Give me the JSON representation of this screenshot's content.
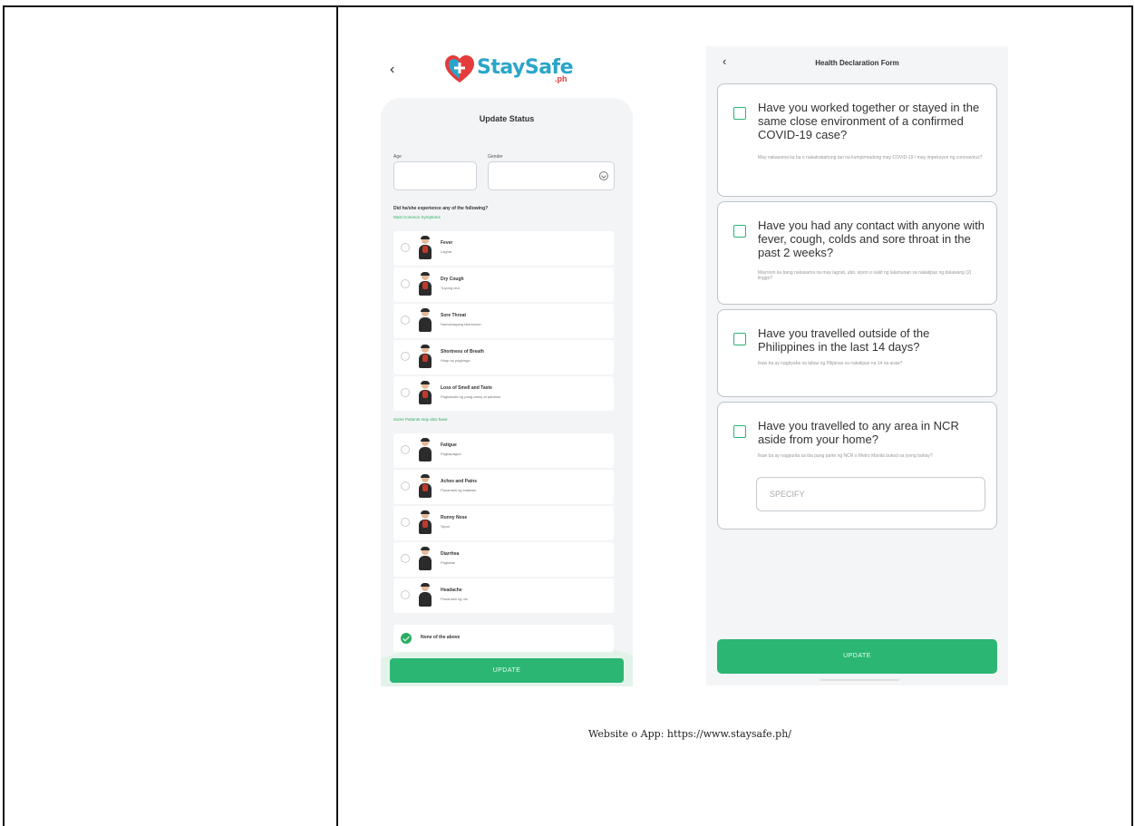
{
  "phone1": {
    "logo_text": "StaySafe",
    "logo_sub": ".ph",
    "title": "Update Status",
    "age_label": "Age",
    "gender_label": "Gender",
    "question": "Did he/she experience any of the following?",
    "section_common": "Most Common Symptoms",
    "section_some": "Some Patients may also have",
    "symptoms": [
      {
        "name": "Fever",
        "sub": "Lagnat"
      },
      {
        "name": "Dry Cough",
        "sub": "Tuyong ubo"
      },
      {
        "name": "Sore Throat",
        "sub": "Namamagang lalamunan"
      },
      {
        "name": "Shortness of Breath",
        "sub": "Hirap sa paghinga"
      },
      {
        "name": "Loss of Smell and Taste",
        "sub": "Pagkawala ng pang-amoy at panlasa"
      }
    ],
    "symptoms_more": [
      {
        "name": "Fatigue",
        "sub": "Pagkapagod"
      },
      {
        "name": "Aches and Pains",
        "sub": "Pananakit ng katawan"
      },
      {
        "name": "Runny Nose",
        "sub": "Sipon"
      },
      {
        "name": "Diarrhea",
        "sub": "Pagtatae"
      },
      {
        "name": "Headache",
        "sub": "Pananakit ng ulo"
      }
    ],
    "none_label": "None of the above",
    "update_label": "UPDATE"
  },
  "phone2": {
    "title": "Health Declaration Form",
    "questions": [
      {
        "q": "Have you worked together or stayed in the same close environment of a confirmed COVID-19 case?",
        "tr": "May nakasama ka ba o nakatrabahong tao na kumpirmadong may COVID-19 / may impeksyon ng coronavirus?"
      },
      {
        "q": "Have you had any contact with anyone with fever, cough, colds and sore throat in the past 2 weeks?",
        "tr": "Mayroon ka bang nakasama na may lagnat, ubo, sipon o sakit ng lalamunan sa nakalipas ng dalawang (2) linggo?"
      },
      {
        "q": "Have you travelled outside of the Philippines in the last 14 days?",
        "tr": "Ikaw ba ay nagbyahe sa labas ng Pilipinas sa nakalipas na 14 na araw?"
      },
      {
        "q": "Have you travelled to any area in NCR aside from your home?",
        "tr": "Ikaw ba ay nagpunta sa iba pang parte ng NCR o Metro Manila bukod sa iyong bahay?"
      }
    ],
    "specify_placeholder": "SPECIFY",
    "update_label": "UPDATE"
  },
  "caption": "Website o App: https://www.staysafe.ph/",
  "colors": {
    "accent": "#2bb673",
    "brand_blue": "#2aa5c9",
    "brand_red": "#e53b3b"
  }
}
